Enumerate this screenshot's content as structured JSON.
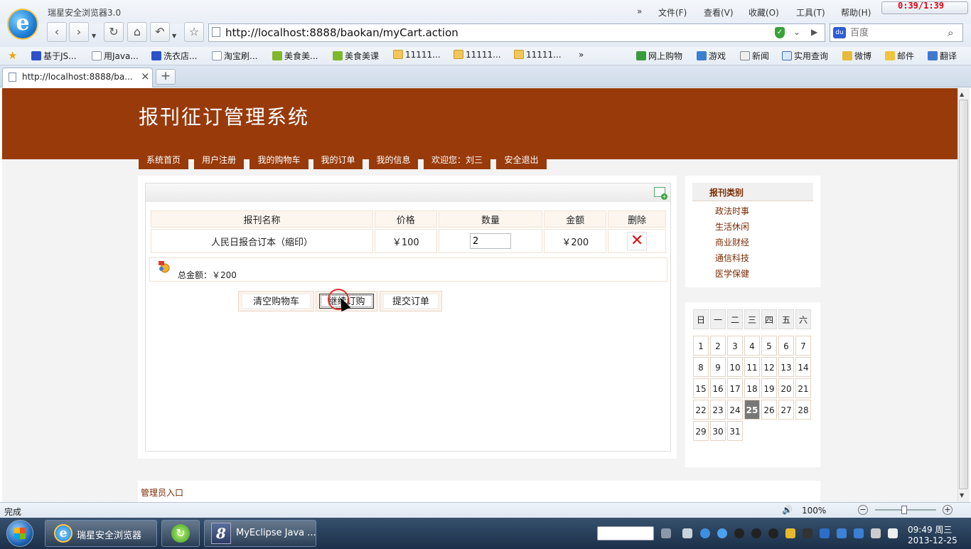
{
  "browser": {
    "title": "瑞星安全浏览器3.0",
    "menus": [
      "文件(F)",
      "查看(V)",
      "收藏(O)",
      "工具(T)",
      "帮助(H)"
    ],
    "menu_more": "»",
    "timer": "0:39/1:39",
    "address": "http://localhost:8888/baokan/myCart.action",
    "search_placeholder": "百度",
    "favorites": [
      "基于JS...",
      "用Java...",
      "洗衣店...",
      "淘宝刷...",
      "美食美...",
      "美食美课",
      "11111...",
      "11111...",
      "11111..."
    ],
    "favorites_more": "»",
    "favorites_right": [
      "网上购物",
      "游戏",
      "新闻",
      "实用查询",
      "微博",
      "邮件",
      "翻译"
    ],
    "tab_title": "http://localhost:8888/ba...",
    "tab_close": "×",
    "new_tab": "+",
    "status": "完成",
    "zoom": "100%"
  },
  "site": {
    "title": "报刊征订管理系统",
    "nav": [
      "系统首页",
      "用户注册",
      "我的购物车",
      "我的订单",
      "我的信息",
      "欢迎您：刘三",
      "安全退出"
    ]
  },
  "cart": {
    "columns": [
      "报刊名称",
      "价格",
      "数量",
      "金额",
      "删除"
    ],
    "rows": [
      {
        "name": "人民日报合订本（缩印）",
        "price": "￥100",
        "quantity": "2",
        "amount": "￥200"
      }
    ],
    "delete_symbol": "✕",
    "total": "总金额：￥200",
    "buttons": {
      "clear": "清空购物车",
      "continue": "继续订购",
      "submit": "提交订单"
    }
  },
  "sidebar": {
    "category_title": "报刊类别",
    "categories": [
      "政法时事",
      "生活休闲",
      "商业财经",
      "通信科技",
      "医学保健"
    ]
  },
  "calendar": {
    "weekdays": [
      "日",
      "一",
      "二",
      "三",
      "四",
      "五",
      "六"
    ],
    "days": [
      "1",
      "2",
      "3",
      "4",
      "5",
      "6",
      "7",
      "8",
      "9",
      "10",
      "11",
      "12",
      "13",
      "14",
      "15",
      "16",
      "17",
      "18",
      "19",
      "20",
      "21",
      "22",
      "23",
      "24",
      "25",
      "26",
      "27",
      "28",
      "29",
      "30",
      "31"
    ],
    "today": "25"
  },
  "footer": {
    "admin_link": "管理员入口"
  },
  "taskbar": {
    "items": [
      "瑞星安全浏览器",
      "MyEclipse Java ..."
    ],
    "time": "09:49 周三",
    "date": "2013-12-25"
  }
}
